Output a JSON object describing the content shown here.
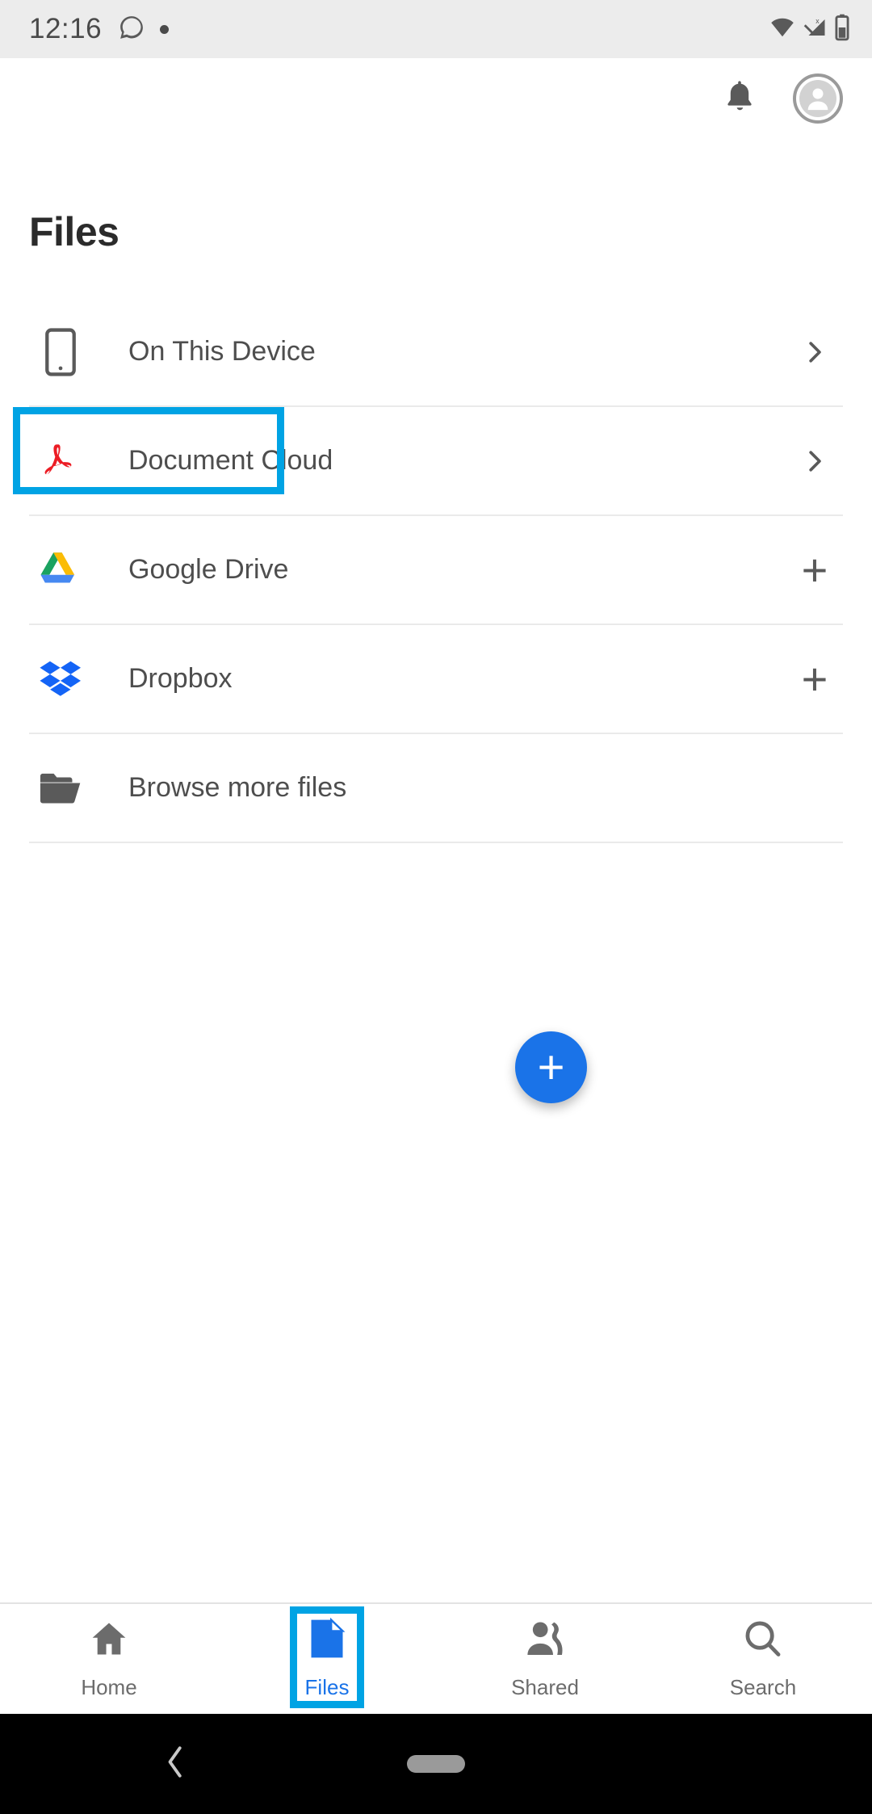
{
  "status_bar": {
    "time": "12:16",
    "icons": [
      "whatsapp-icon",
      "dot-indicator",
      "wifi-icon",
      "signal-icon",
      "battery-icon"
    ]
  },
  "app_bar": {
    "notification_icon": "bell-icon",
    "avatar_icon": "account-avatar-icon"
  },
  "page": {
    "title": "Files"
  },
  "file_locations": [
    {
      "label": "On This Device",
      "icon": "device-phone-icon",
      "trailing": "chevron-right-icon",
      "highlighted": false
    },
    {
      "label": "Document Cloud",
      "icon": "adobe-acrobat-icon",
      "trailing": "chevron-right-icon",
      "highlighted": true
    },
    {
      "label": "Google Drive",
      "icon": "google-drive-icon",
      "trailing": "plus-icon",
      "highlighted": false
    },
    {
      "label": "Dropbox",
      "icon": "dropbox-icon",
      "trailing": "plus-icon",
      "highlighted": false
    },
    {
      "label": "Browse more files",
      "icon": "folder-open-icon",
      "trailing": "none",
      "highlighted": false
    }
  ],
  "fab": {
    "label": "+",
    "icon": "plus-icon",
    "color": "#1a73e8"
  },
  "bottom_nav": {
    "items": [
      {
        "label": "Home",
        "icon": "home-icon",
        "active": false,
        "highlighted": false
      },
      {
        "label": "Files",
        "icon": "document-icon",
        "active": true,
        "highlighted": true
      },
      {
        "label": "Shared",
        "icon": "people-icon",
        "active": false,
        "highlighted": false
      },
      {
        "label": "Search",
        "icon": "search-icon",
        "active": false,
        "highlighted": false
      }
    ]
  },
  "system_nav": {
    "back_icon": "back-chevron-icon",
    "home_pill": "home-pill-indicator"
  },
  "colors": {
    "accent": "#1a73e8",
    "highlight_border": "#00a3e4",
    "status_bar_bg": "#ececec",
    "text_primary": "#2b2b2b",
    "text_secondary": "#4e4e4e"
  }
}
